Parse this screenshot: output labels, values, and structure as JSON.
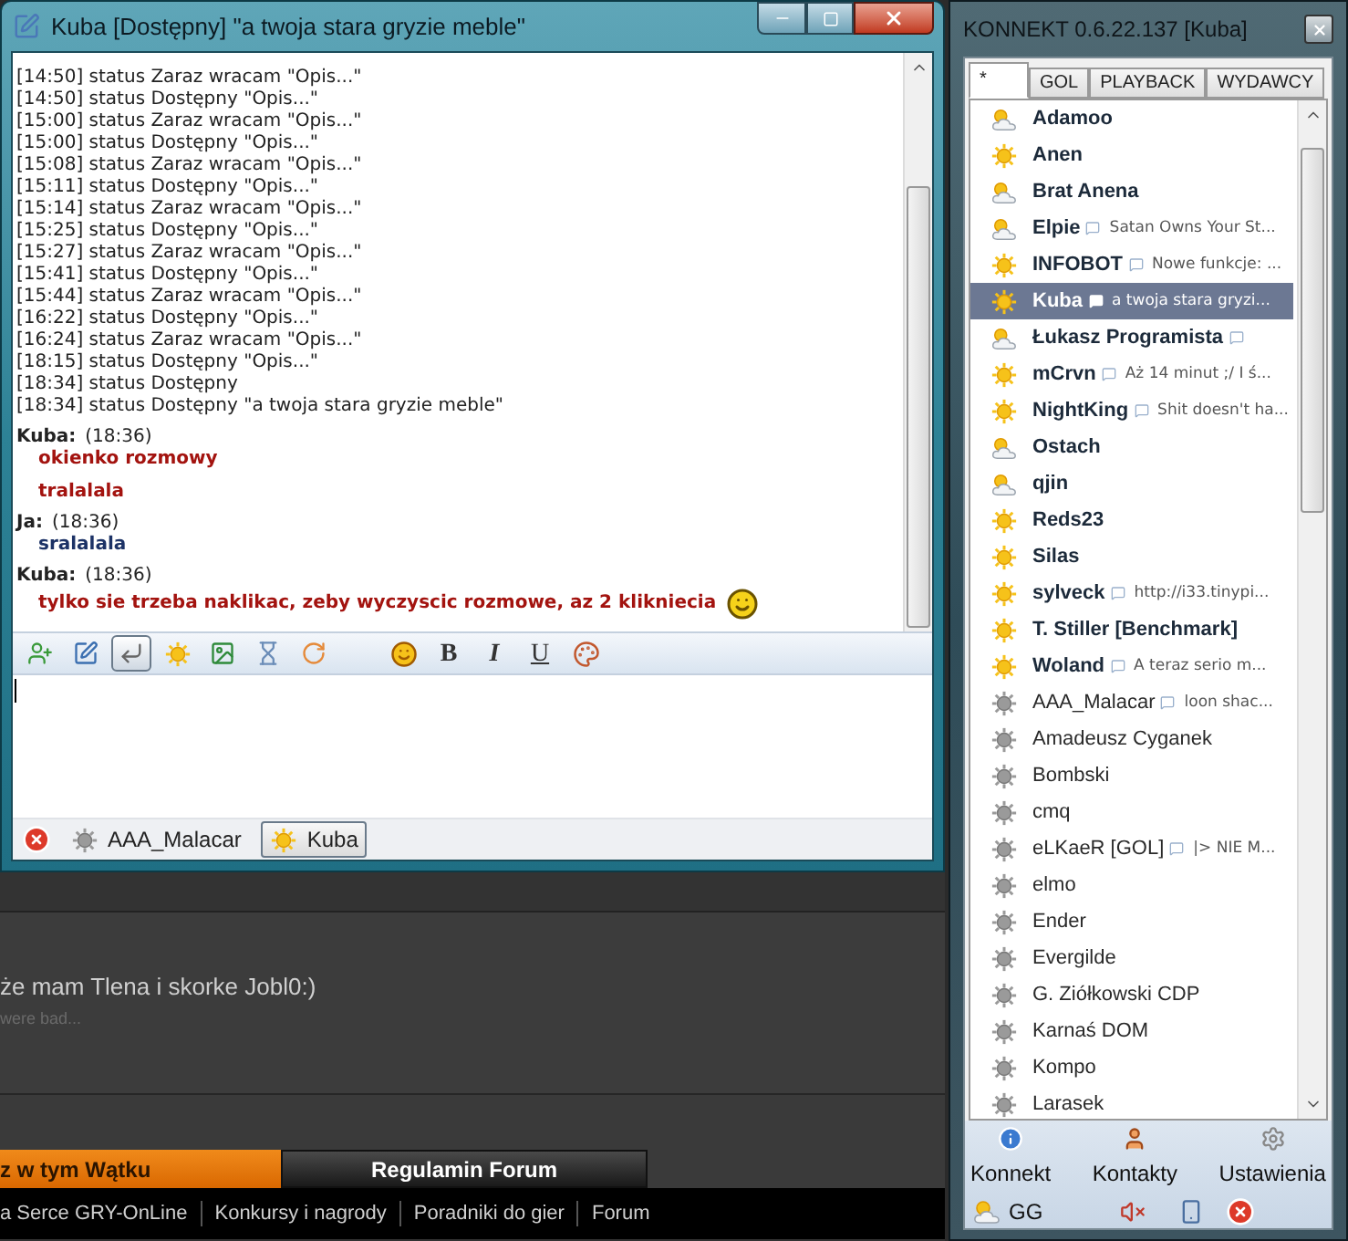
{
  "chat_window": {
    "title": "Kuba [Dostępny] \"a twoja stara gryzie meble\"",
    "status_log": [
      "[14:50] status Zaraz wracam \"Opis...\"",
      "[14:50] status Dostępny \"Opis...\"",
      "[15:00] status Zaraz wracam \"Opis...\"",
      "[15:00] status Dostępny \"Opis...\"",
      "[15:08] status Zaraz wracam \"Opis...\"",
      "[15:11] status Dostępny \"Opis...\"",
      "[15:14] status Zaraz wracam \"Opis...\"",
      "[15:25] status Dostępny \"Opis...\"",
      "[15:27] status Zaraz wracam \"Opis...\"",
      "[15:41] status Dostępny \"Opis...\"",
      "[15:44] status Zaraz wracam \"Opis...\"",
      "[16:22] status Dostępny \"Opis...\"",
      "[16:24] status Zaraz wracam \"Opis...\"",
      "[18:15] status Dostępny \"Opis...\"",
      "[18:34] status Dostępny",
      "[18:34] status Dostępny \"a twoja stara gryzie meble\""
    ],
    "messages": [
      {
        "sender": "Kuba:",
        "time": "(18:36)",
        "own": false,
        "lines": [
          "okienko rozmowy",
          "tralalala"
        ],
        "emoticon": false
      },
      {
        "sender": "Ja:",
        "time": "(18:36)",
        "own": true,
        "lines": [
          "sralalala"
        ],
        "emoticon": false
      },
      {
        "sender": "Kuba:",
        "time": "(18:36)",
        "own": false,
        "lines": [
          "tylko sie trzeba naklikac, zeby wyczyscic rozmowe, az 2 klikniecia"
        ],
        "emoticon": true
      }
    ],
    "tool_buttons": [
      {
        "pressed": false
      },
      {
        "pressed": false
      },
      {
        "pressed": true
      },
      {
        "pressed": false
      },
      {
        "pressed": false
      },
      {
        "pressed": false
      },
      {
        "pressed": false
      }
    ],
    "format_buttons": [
      "B",
      "I",
      "U"
    ],
    "tabs": [
      {
        "label": "AAA_Malacar",
        "kind": "offline",
        "selected": false
      },
      {
        "label": "Kuba",
        "kind": "online",
        "selected": true
      }
    ]
  },
  "forum": {
    "post_text": "że mam Tlena i skorke Jobl0:)",
    "signature": "were bad...",
    "nav_tabs": [
      {
        "label": "z w tym Wątku",
        "selected": true
      },
      {
        "label": "Regulamin Forum",
        "selected": false
      }
    ],
    "footer_links": [
      "a Serce GRY-OnLine",
      "Konkursy i nagrody",
      "Poradniki do gier",
      "Forum"
    ]
  },
  "contact_window": {
    "title": "KONNEKT 0.6.22.137 [Kuba]",
    "tabs": [
      {
        "label": "*",
        "selected": true
      },
      {
        "label": "GOL",
        "selected": false
      },
      {
        "label": "PLAYBACK",
        "selected": false
      },
      {
        "label": "WYDAWCY",
        "selected": false
      }
    ],
    "contacts": [
      {
        "name": "Adamoo",
        "kind": "away",
        "bubble": false,
        "selected": false
      },
      {
        "name": "Anen",
        "kind": "online",
        "bubble": false,
        "selected": false
      },
      {
        "name": "Brat Anena",
        "kind": "away",
        "bubble": false,
        "selected": false
      },
      {
        "name": "Elpie",
        "kind": "away",
        "bubble": true,
        "description": "Satan Owns Your St...",
        "selected": false
      },
      {
        "name": "INFOBOT",
        "kind": "online",
        "bubble": true,
        "description": "Nowe funkcje: ...",
        "selected": false
      },
      {
        "name": "Kuba",
        "kind": "online",
        "bubble": true,
        "description": "a twoja stara gryzi...",
        "selected": true
      },
      {
        "name": "Łukasz Programista",
        "kind": "away",
        "bubble": true,
        "selected": false
      },
      {
        "name": "mCrvn",
        "kind": "online",
        "bubble": true,
        "description": "Aż 14 minut ;/ I ś...",
        "selected": false
      },
      {
        "name": "NightKing",
        "kind": "online",
        "bubble": true,
        "description": "Shit doesn't ha...",
        "selected": false
      },
      {
        "name": "Ostach",
        "kind": "away",
        "bubble": false,
        "selected": false
      },
      {
        "name": "qjin",
        "kind": "away",
        "bubble": false,
        "selected": false
      },
      {
        "name": "Reds23",
        "kind": "online",
        "bubble": false,
        "selected": false
      },
      {
        "name": "Silas",
        "kind": "online",
        "bubble": false,
        "selected": false
      },
      {
        "name": "sylveck",
        "kind": "online",
        "bubble": true,
        "description": "http://i33.tinypi...",
        "selected": false
      },
      {
        "name": "T. Stiller [Benchmark]",
        "kind": "online",
        "bubble": false,
        "selected": false
      },
      {
        "name": "Woland",
        "kind": "online",
        "bubble": true,
        "description": "A teraz serio m...",
        "selected": false
      },
      {
        "name": "AAA_Malacar",
        "kind": "offline",
        "bubble": true,
        "description": "loon shac...",
        "selected": false
      },
      {
        "name": "Amadeusz Cyganek",
        "kind": "offline",
        "bubble": false,
        "selected": false
      },
      {
        "name": "Bombski",
        "kind": "offline",
        "bubble": false,
        "selected": false
      },
      {
        "name": "cmq",
        "kind": "offline",
        "bubble": false,
        "selected": false
      },
      {
        "name": "eLKaeR [GOL]",
        "kind": "offline",
        "bubble": true,
        "description": "|> NIE M...",
        "selected": false
      },
      {
        "name": "elmo",
        "kind": "offline",
        "bubble": false,
        "selected": false
      },
      {
        "name": "Ender",
        "kind": "offline",
        "bubble": false,
        "selected": false
      },
      {
        "name": "Evergilde",
        "kind": "offline",
        "bubble": false,
        "selected": false
      },
      {
        "name": "G. Ziółkowski CDP",
        "kind": "offline",
        "bubble": false,
        "selected": false
      },
      {
        "name": "Karnaś DOM",
        "kind": "offline",
        "bubble": false,
        "selected": false
      },
      {
        "name": "Kompo",
        "kind": "offline",
        "bubble": false,
        "selected": false
      },
      {
        "name": "Larasek",
        "kind": "offline",
        "bubble": false,
        "selected": false
      }
    ],
    "main_buttons": [
      {
        "kind": "info",
        "label": "Konnekt"
      },
      {
        "kind": "contacts",
        "label": "Kontakty"
      },
      {
        "kind": "settings",
        "label": "Ustawienia"
      }
    ],
    "status_network": {
      "label": "GG",
      "kind": "away"
    }
  }
}
